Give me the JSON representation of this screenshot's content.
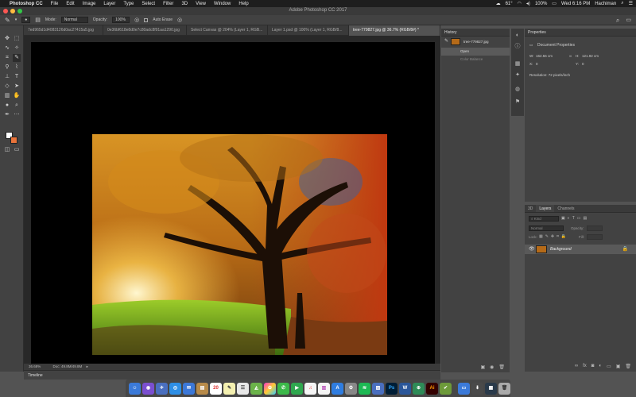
{
  "menubar": {
    "app": "Photoshop CC",
    "items": [
      "File",
      "Edit",
      "Image",
      "Layer",
      "Type",
      "Select",
      "Filter",
      "3D",
      "View",
      "Window",
      "Help"
    ],
    "temperature": "61°",
    "battery": "100%",
    "clock": "Wed 6:16 PM",
    "user": "Hachiman"
  },
  "window": {
    "title": "Adobe Photoshop CC 2017"
  },
  "options_bar": {
    "mode_label": "Mode:",
    "mode_value": "Normal",
    "opacity_label": "Opacity:",
    "opacity_value": "100%",
    "auto_erase": "Auto Erase"
  },
  "tabs": [
    {
      "label": "7ed965d1d4083126d0ac27415a5.jpg"
    },
    {
      "label": "0e36bf618e8d0e7c80adc8f91aa1290.jpg"
    },
    {
      "label": "Select Canvas @ 204% (Layer 1, RGB..."
    },
    {
      "label": "Layer 1.psd @ 100% (Layer 1, RGB/8..."
    },
    {
      "label": "tree-779827.jpg @ 36.7% (RGB/8#) *"
    }
  ],
  "status": {
    "zoom": "36.68%",
    "doc": "Doc: 49.8M/49.8M"
  },
  "timeline": {
    "label": "Timeline"
  },
  "history": {
    "title": "History",
    "snapshot": "tree-779827.jpg",
    "items": [
      "Open",
      "Color Balance"
    ]
  },
  "properties": {
    "title": "Properties",
    "section": "Document Properties",
    "w_label": "W:",
    "w_value": "162.56 cm",
    "h_label": "H:",
    "h_value": "121.92 cm",
    "x_label": "X:",
    "x_value": "0",
    "y_label": "Y:",
    "y_value": "0",
    "resolution": "Resolution: 72 pixels/inch"
  },
  "layers": {
    "tabs": [
      "3D",
      "Layers",
      "Channels"
    ],
    "kind_placeholder": "Kind",
    "blend_mode": "Normal",
    "opacity_label": "Opacity:",
    "lock_label": "Lock:",
    "fill_label": "Fill:",
    "layer_name": "Background"
  },
  "dock": {
    "calendar_day": "20",
    "labels": [
      "Ps",
      "W",
      "Ai"
    ]
  },
  "colors": {
    "foreground": "#ffffff",
    "background": "#e8733a",
    "photoshop_blue": "#31a8ff",
    "illustrator_orange": "#ff9a00"
  }
}
